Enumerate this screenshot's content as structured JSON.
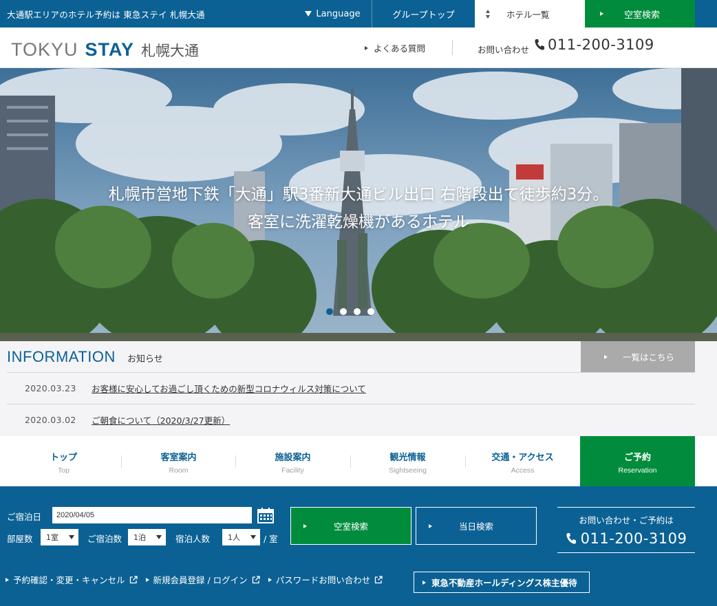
{
  "topbar": {
    "tagline": "大通駅エリアのホテル予約は 東急ステイ 札幌大通",
    "language": "Language",
    "group_top": "グループトップ",
    "hotel_list": "ホテル一覧",
    "vacancy_search": "空室検索"
  },
  "header": {
    "logo_tokyu": "TOKYU",
    "logo_stay": "STAY",
    "logo_city": "札幌大通",
    "faq": "よくある質問",
    "contact_label": "お問い合わせ",
    "phone": "011-200-3109"
  },
  "hero": {
    "caption_line1": "札幌市営地下鉄「大通」駅3番新大通ビル出口 右階段出て徒歩約3分。",
    "caption_line2": "客室に洗濯乾燥機があるホテル",
    "slide_count": 4,
    "active_slide": 1
  },
  "info": {
    "title": "INFORMATION",
    "subtitle": "お知らせ",
    "list_button": "一覧はこちら",
    "items": [
      {
        "date": "2020.03.23",
        "text": "お客様に安心してお過ごし頂くための新型コロナウィルス対策について"
      },
      {
        "date": "2020.03.02",
        "text": "ご朝食について（2020/3/27更新）"
      }
    ]
  },
  "nav": {
    "items": [
      {
        "jp": "トップ",
        "en": "Top"
      },
      {
        "jp": "客室案内",
        "en": "Room"
      },
      {
        "jp": "施設案内",
        "en": "Facility"
      },
      {
        "jp": "観光情報",
        "en": "Sightseeing"
      },
      {
        "jp": "交通・アクセス",
        "en": "Access"
      },
      {
        "jp": "ご予約",
        "en": "Reservation"
      }
    ]
  },
  "booking": {
    "checkin_label": "ご宿泊日",
    "checkin_value": "2020/04/05",
    "rooms_label": "部屋数",
    "rooms_value": "1室",
    "nights_label": "ご宿泊数",
    "nights_value": "1泊",
    "guests_label": "宿泊人数",
    "guests_value": "1人",
    "per_room": "/ 室",
    "search_button": "空室検索",
    "today_button": "当日検索",
    "contact_label": "お問い合わせ・ご予約は",
    "phone": "011-200-3109",
    "links": [
      "予約確認・変更・キャンセル",
      "新規会員登録 / ログイン",
      "パスワードお問い合わせ"
    ],
    "shareholder": "東急不動産ホールディングス株主優待"
  },
  "colors": {
    "brand_blue": "#0b6194",
    "accent_green": "#008c3c",
    "info_button_gray": "#aaaaaa"
  }
}
